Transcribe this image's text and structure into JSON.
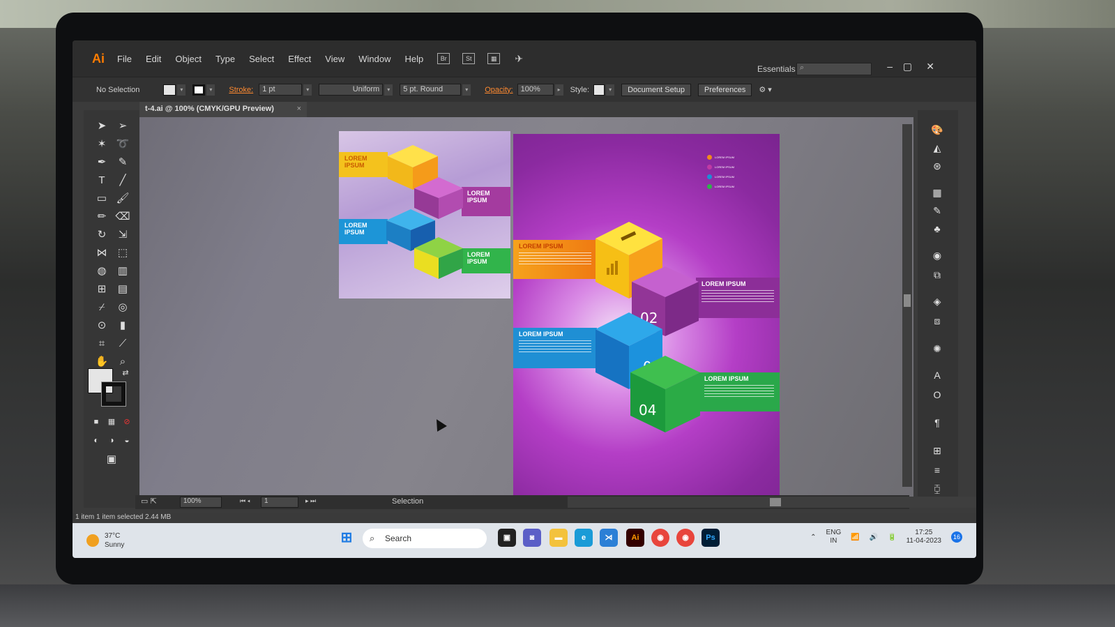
{
  "window": {
    "doc_tab": "t-4.ai @ 100% (CMYK/GPU Preview)",
    "close_glyph": "×"
  },
  "menubar": {
    "logo": "Ai",
    "items": [
      "File",
      "Edit",
      "Object",
      "Type",
      "Select",
      "Effect",
      "View",
      "Window",
      "Help"
    ],
    "icons": [
      "Br",
      "St"
    ],
    "workspace": "Essentials"
  },
  "controlbar": {
    "selection": "No Selection",
    "stroke_label": "Stroke:",
    "stroke_weight": "1 pt",
    "stroke_profile": "Uniform",
    "brush": "5 pt. Round",
    "opacity_label": "Opacity:",
    "opacity_value": "100%",
    "style_label": "Style:",
    "document_setup": "Document Setup",
    "preferences": "Preferences"
  },
  "artwork": {
    "labels": [
      "LOREM IPSUM",
      "LOREM IPSUM",
      "LOREM IPSUM",
      "LOREM IPSUM"
    ],
    "numbers": [
      "02",
      "03",
      "04"
    ],
    "legend": [
      "LOREM IPSUM",
      "LOREM IPSUM",
      "LOREM IPSUM",
      "LOREM IPSUM"
    ],
    "colors": {
      "orange": "#f08a1c",
      "purple": "#8f3aa6",
      "blue": "#1c8fd6",
      "green": "#2fb24a",
      "yellow": "#f2c320"
    }
  },
  "statusbar": {
    "zoom": "100%",
    "page": "1",
    "mode": "Selection"
  },
  "infobar": {
    "text": "1 item    1 item selected  2.44 MB"
  },
  "taskbar": {
    "temp": "37°C",
    "weather": "Sunny",
    "search": "Search",
    "lang": "ENG",
    "region": "IN",
    "time": "17:25",
    "date": "11-04-2023",
    "badge": "16",
    "apps": [
      "Ai",
      "Ps"
    ]
  }
}
